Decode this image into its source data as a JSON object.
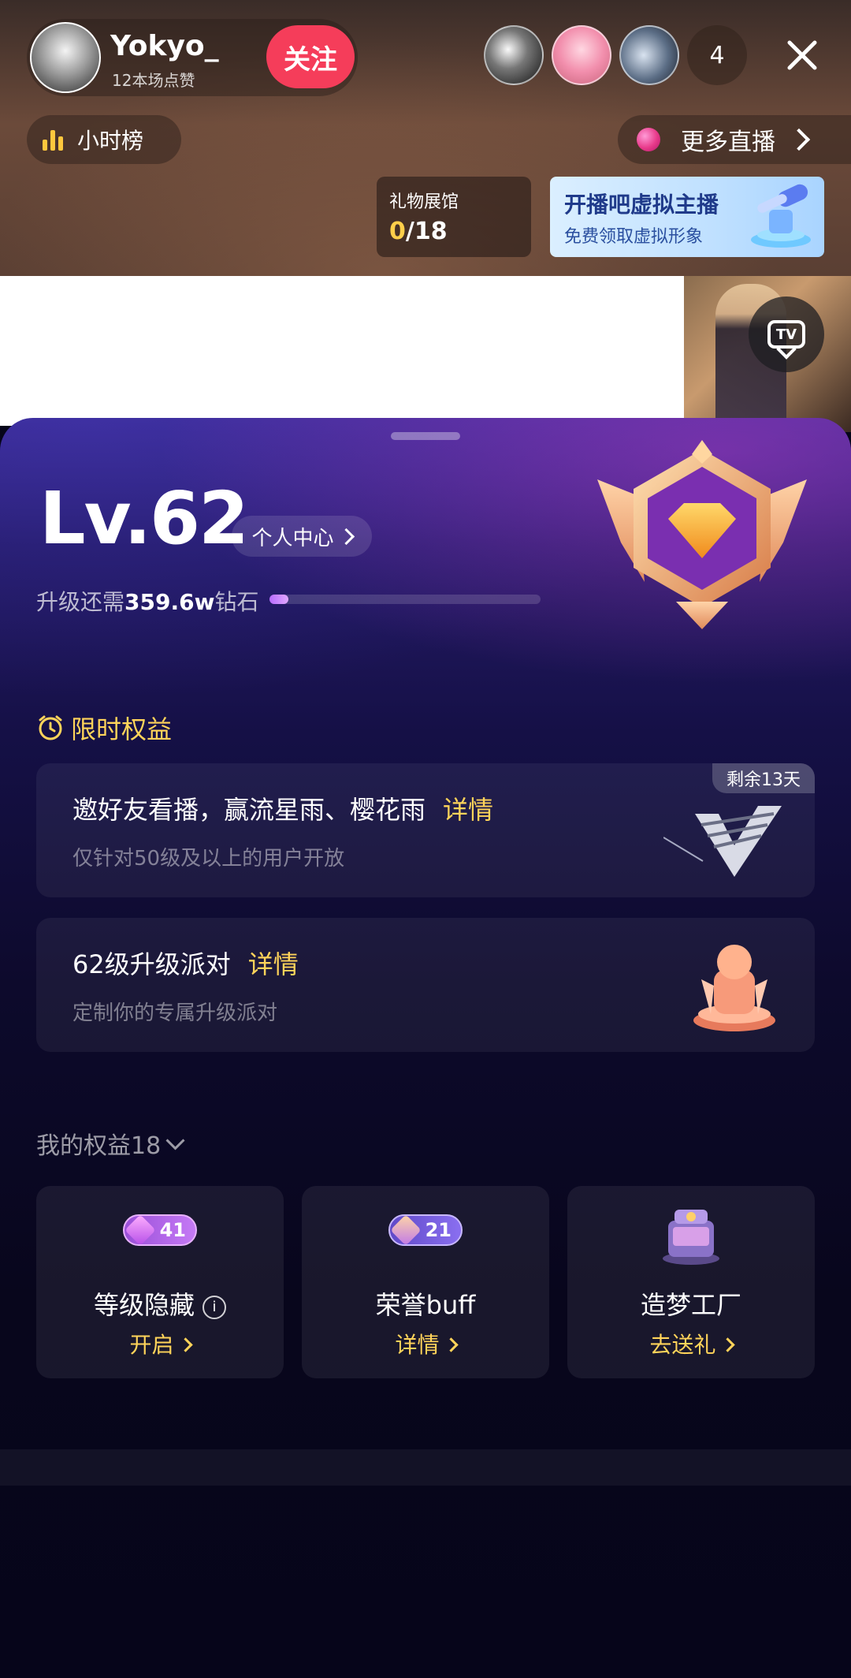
{
  "header": {
    "host_name": "Yokyo_",
    "host_subtitle": "12本场点赞",
    "follow_label": "关注",
    "viewer_count": "4",
    "hour_rank_label": "小时榜",
    "more_live_label": "更多直播",
    "gift_hall_title": "礼物展馆",
    "gift_hall_progress_current": "0",
    "gift_hall_progress_total": "/18",
    "virtual_banner_title": "开播吧虚拟主播",
    "virtual_banner_subtitle": "免费领取虚拟形象",
    "tv_label": "TV"
  },
  "panel": {
    "level": "Lv.62",
    "personal_center_label": "个人中心",
    "upgrade_prefix": "升级还需",
    "upgrade_amount": "359.6w",
    "upgrade_suffix": "钻石",
    "upgrade_progress": 0.07,
    "limited_section_label": "限时权益",
    "cards": [
      {
        "title": "邀好友看播，赢流星雨、樱花雨",
        "detail": "详情",
        "subtitle": "仅针对50级及以上的用户开放",
        "tag": "剩余13天"
      },
      {
        "title": "62级升级派对",
        "detail": "详情",
        "subtitle": "定制你的专属升级派对"
      }
    ],
    "my_rights_label": "我的权益18",
    "tiles": [
      {
        "badge": "41",
        "title": "等级隐藏",
        "info": "i",
        "action": "开启"
      },
      {
        "badge": "21",
        "title": "荣誉buff",
        "action": "详情"
      },
      {
        "title": "造梦工厂",
        "action": "去送礼"
      }
    ]
  },
  "colors": {
    "accent_gold": "#ffd45a",
    "follow_red": "#f53d5a",
    "panel_bg": "#06051a"
  }
}
